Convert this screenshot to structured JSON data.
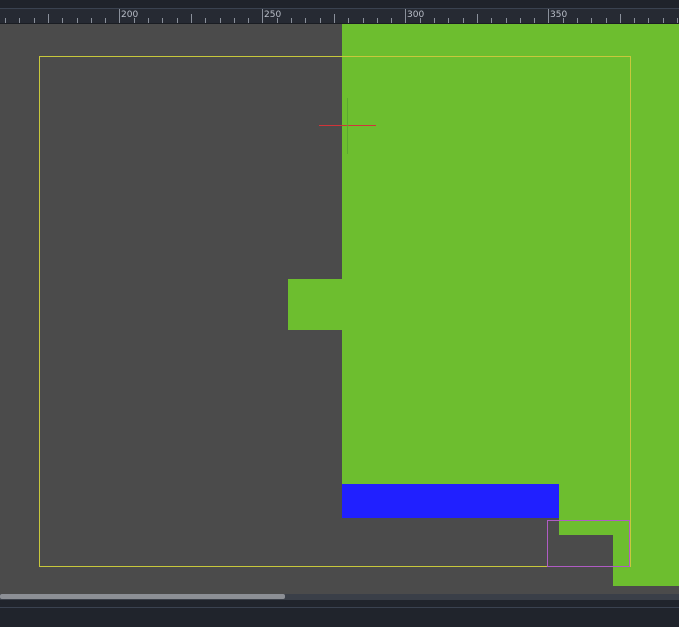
{
  "ruler": {
    "labels": [
      "200",
      "250",
      "300",
      "350"
    ]
  },
  "colors": {
    "background": "#4b4b4b",
    "green": "#6dbe2f",
    "blue": "#2020ff",
    "frame": "#c8c83c",
    "selection": "#b05cc4",
    "cursor_x_axis": "#d0343a",
    "cursor_y_axis": "#5aa82e"
  },
  "canvas": {
    "shapes": [
      {
        "name": "green-shape-main",
        "color_key": "green"
      },
      {
        "name": "green-shape-tab",
        "color_key": "green"
      },
      {
        "name": "green-shape-step",
        "color_key": "green"
      },
      {
        "name": "green-shape-foot",
        "color_key": "green"
      },
      {
        "name": "blue-shape-bar",
        "color_key": "blue"
      }
    ]
  },
  "scrollbar": {
    "horizontal_thumb_fraction": 0.42
  }
}
